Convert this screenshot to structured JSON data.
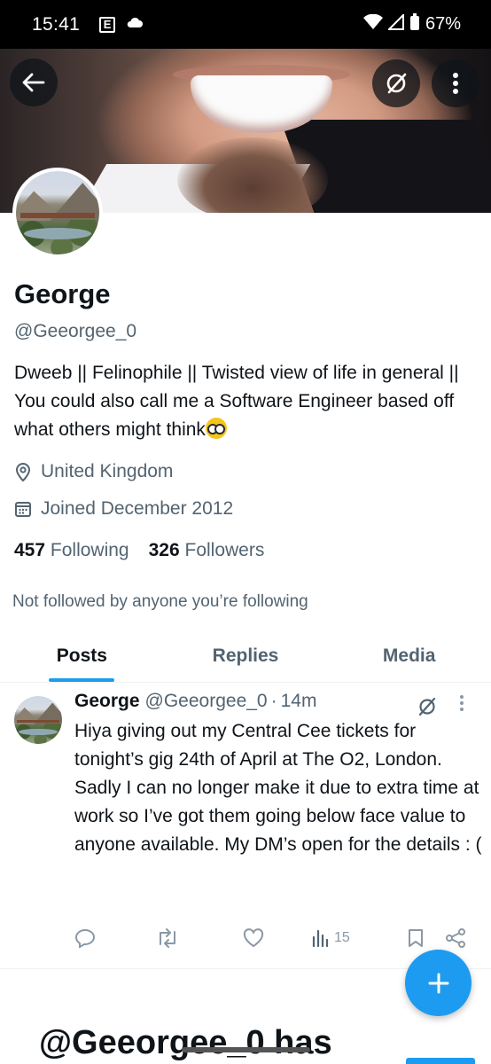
{
  "status_bar": {
    "time": "15:41",
    "app_badge": "E",
    "battery": "67%"
  },
  "profile": {
    "display_name": "George",
    "handle": "@Geeorgee_0",
    "bio": "Dweeb || Felinophile || Twisted view of life in general || You could also call me a Software Engineer based off what others might think",
    "location": "United Kingdom",
    "joined": "Joined December 2012",
    "following_count": "457",
    "following_label": "Following",
    "followers_count": "326",
    "followers_label": "Followers",
    "followed_note": "Not followed by anyone you’re following"
  },
  "tabs": [
    {
      "label": "Posts",
      "active": true
    },
    {
      "label": "Replies",
      "active": false
    },
    {
      "label": "Media",
      "active": false
    }
  ],
  "post": {
    "name": "George",
    "handle": "@Geeorgee_0",
    "separator": "·",
    "time": "14m",
    "text": "Hiya giving out my Central Cee tickets for tonight’s gig 24th of April at The O2, London. Sadly I can no longer make it due to extra time at work so I’ve got them going below face value to anyone available. My DM’s open for the details : (",
    "views": "15"
  },
  "bottom_heading": "@Geeorgee_0 has",
  "colors": {
    "accent": "#1d9bf0",
    "secondary_text": "#536471",
    "primary_text": "#0f1419"
  },
  "icons": [
    "back-arrow-icon",
    "grok-icon",
    "more-vertical-icon",
    "location-pin-icon",
    "calendar-icon",
    "reply-icon",
    "repost-icon",
    "like-icon",
    "views-icon",
    "bookmark-icon",
    "share-icon",
    "compose-plus-icon"
  ]
}
